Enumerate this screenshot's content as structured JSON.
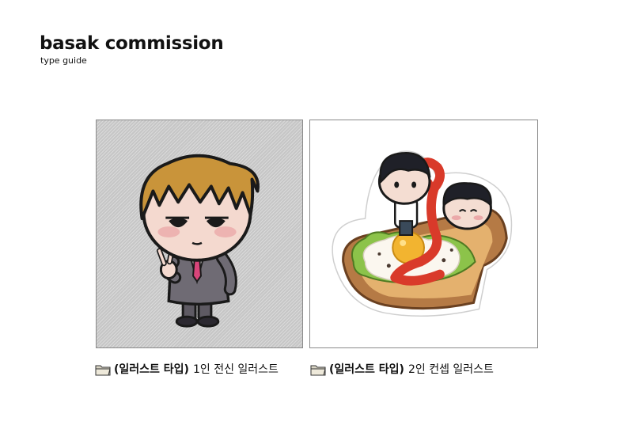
{
  "header": {
    "title": "basak commission",
    "subtitle": "type guide"
  },
  "illustrations": [
    {
      "icon": "folder-icon",
      "type_label": "(일러스트 타입)",
      "description": "1인 전신 일러스트"
    },
    {
      "icon": "folder-icon",
      "type_label": "(일러스트 타입)",
      "description": "2인 컨셉 일러스트"
    }
  ],
  "colors": {
    "frame_background": "#c6c6c6",
    "hair_blonde": "#c9943a",
    "suit_gray": "#6f6b74",
    "tie_pink": "#d8457a",
    "toast_brown": "#b57a45",
    "egg_yolk": "#f2b430",
    "ketchup_red": "#d93a2a",
    "lettuce_green": "#8cc34a"
  }
}
